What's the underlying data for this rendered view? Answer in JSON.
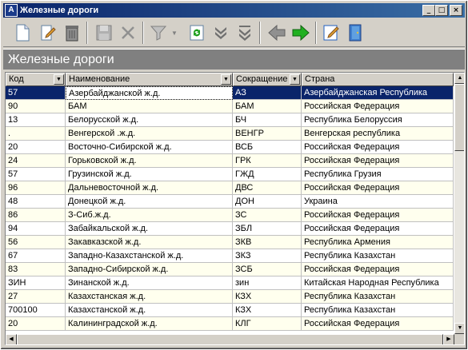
{
  "window": {
    "title": "Железные дороги"
  },
  "toolbar": {
    "buttons": [
      "new-doc-icon",
      "edit-icon",
      "delete-icon",
      "save-icon",
      "cancel-icon",
      "filter-icon",
      "refresh-icon",
      "expand-down-icon",
      "collapse-down-icon",
      "back-arrow-icon",
      "forward-arrow-icon",
      "edit-form-icon",
      "exit-door-icon"
    ]
  },
  "section": {
    "title": "Железные дороги"
  },
  "grid": {
    "columns": [
      "Код",
      "Наименование",
      "Сокращение",
      "Страна"
    ],
    "rows": [
      [
        "57",
        "Азербайджанской ж.д.",
        "АЗ",
        "Азербайджанская Республика"
      ],
      [
        "90",
        "БАМ",
        "БАМ",
        "Российская Федерация"
      ],
      [
        "13",
        "Белорусской ж.д.",
        "БЧ",
        "Республика Белоруссия"
      ],
      [
        ".",
        "Венгерской .ж.д.",
        "ВЕНГР",
        "Венгерская республика"
      ],
      [
        "20",
        "Восточно-Сибирской ж.д.",
        "ВСБ",
        "Российская Федерация"
      ],
      [
        "24",
        "Горьковской ж.д.",
        "ГРК",
        "Российская Федерация"
      ],
      [
        "57",
        "Грузинской ж.д.",
        "ГЖД",
        "Республика Грузия"
      ],
      [
        "96",
        "Дальневосточной ж.д.",
        "ДВС",
        "Российская Федерация"
      ],
      [
        "48",
        "Донецкой ж.д.",
        "ДОН",
        "Украина"
      ],
      [
        "86",
        "З-Сиб.ж.д.",
        "ЗС",
        "Российская Федерация"
      ],
      [
        "94",
        "Забайкальской ж.д.",
        "ЗБЛ",
        "Российская Федерация"
      ],
      [
        "56",
        "Закавказской ж.д.",
        "ЗКВ",
        "Республика Армения"
      ],
      [
        "67",
        "Западно-Казахстанской ж.д.",
        "ЗКЗ",
        "Республика Казахстан"
      ],
      [
        "83",
        "Западно-Сибирской ж.д.",
        "ЗСБ",
        "Российская Федерация"
      ],
      [
        "ЗИН",
        "Зинанской ж.д.",
        "зин",
        "Китайская Народная Республика"
      ],
      [
        "27",
        "Казахстанская ж.д.",
        "КЗХ",
        "Республика Казахстан"
      ],
      [
        "700100",
        "Казахстанской ж.д.",
        "КЗХ",
        "Республика Казахстан"
      ],
      [
        "20",
        "Калининградской ж.д.",
        "КЛГ",
        "Российская Федерация"
      ]
    ]
  },
  "colors": {
    "title_start": "#0a246a",
    "title_end": "#3a6ea5",
    "selection": "#0a246a",
    "alt_row": "#ffffee",
    "section_bg": "#808080"
  }
}
